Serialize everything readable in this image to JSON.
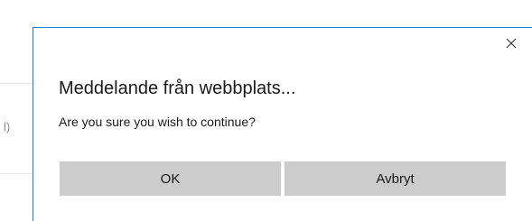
{
  "background": {
    "fragment_text": "l)"
  },
  "dialog": {
    "title": "Meddelande från webbplats...",
    "message": "Are you sure you wish to continue?",
    "close_icon": "close-icon",
    "buttons": {
      "ok_label": "OK",
      "cancel_label": "Avbryt"
    },
    "colors": {
      "border": "#1e7fd8",
      "button_bg": "#cccccc",
      "text": "#1a1a1a"
    }
  }
}
